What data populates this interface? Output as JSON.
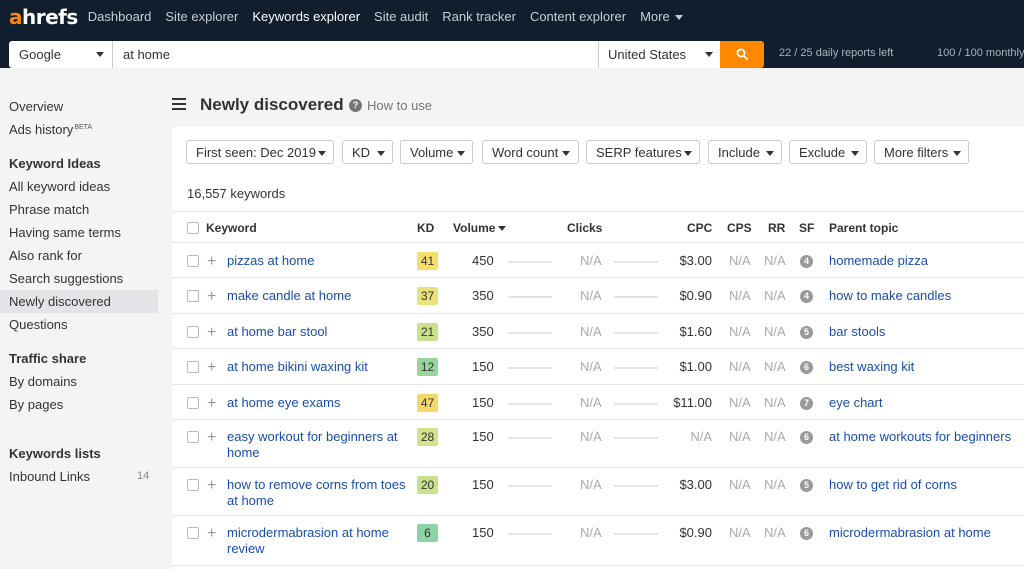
{
  "brand": {
    "logo_a": "a",
    "logo_rest": "hrefs",
    "accent": "#ff8800",
    "nav_bg": "#111e2e",
    "link_color": "#1a4dad"
  },
  "nav": {
    "items": [
      "Dashboard",
      "Site explorer",
      "Keywords explorer",
      "Site audit",
      "Rank tracker",
      "Content explorer",
      "More"
    ],
    "active": "Keywords explorer"
  },
  "search": {
    "engine": "Google",
    "query": "at home",
    "country": "United States",
    "button_icon": "search-icon",
    "reports_left": "22 / 25 daily reports left",
    "monthly": "100 / 100 monthly"
  },
  "sidebar": {
    "overview": "Overview",
    "ads_history": "Ads history",
    "beta": "BETA",
    "keyword_ideas_heading": "Keyword Ideas",
    "keyword_ideas": [
      "All keyword ideas",
      "Phrase match",
      "Having same terms",
      "Also rank for",
      "Search suggestions",
      "Newly discovered",
      "Questions"
    ],
    "active": "Newly discovered",
    "traffic_heading": "Traffic share",
    "traffic_items": [
      "By domains",
      "By pages"
    ],
    "lists_heading": "Keywords lists",
    "inbound_links": "Inbound Links",
    "inbound_count": "14"
  },
  "page": {
    "title": "Newly discovered",
    "how_to": "How to use",
    "keyword_count": "16,557 keywords"
  },
  "filters": [
    "First seen: Dec 2019",
    "KD",
    "Volume",
    "Word count",
    "SERP features",
    "Include",
    "Exclude",
    "More filters"
  ],
  "table": {
    "headers": {
      "keyword": "Keyword",
      "kd": "KD",
      "volume": "Volume",
      "clicks": "Clicks",
      "cpc": "CPC",
      "cps": "CPS",
      "rr": "RR",
      "sf": "SF",
      "parent": "Parent topic"
    },
    "rows": [
      {
        "keyword": "pizzas at home",
        "kd": "41",
        "kd_color": "#f5de6a",
        "volume": "450",
        "clicks": "N/A",
        "cpc": "$3.00",
        "cps": "N/A",
        "rr": "N/A",
        "sf": "4",
        "parent": "homemade pizza"
      },
      {
        "keyword": "make candle at home",
        "kd": "37",
        "kd_color": "#e8e27a",
        "volume": "350",
        "clicks": "N/A",
        "cpc": "$0.90",
        "cps": "N/A",
        "rr": "N/A",
        "sf": "4",
        "parent": "how to make candles"
      },
      {
        "keyword": "at home bar stool",
        "kd": "21",
        "kd_color": "#c9e08c",
        "volume": "350",
        "clicks": "N/A",
        "cpc": "$1.60",
        "cps": "N/A",
        "rr": "N/A",
        "sf": "5",
        "parent": "bar stools"
      },
      {
        "keyword": "at home bikini waxing kit",
        "kd": "12",
        "kd_color": "#97d69b",
        "volume": "150",
        "clicks": "N/A",
        "cpc": "$1.00",
        "cps": "N/A",
        "rr": "N/A",
        "sf": "6",
        "parent": "best waxing kit"
      },
      {
        "keyword": "at home eye exams",
        "kd": "47",
        "kd_color": "#f5d86a",
        "volume": "150",
        "clicks": "N/A",
        "cpc": "$11.00",
        "cps": "N/A",
        "rr": "N/A",
        "sf": "7",
        "parent": "eye chart"
      },
      {
        "keyword": "easy workout for beginners at home",
        "kd": "28",
        "kd_color": "#d4e08a",
        "volume": "150",
        "clicks": "N/A",
        "cpc": "N/A",
        "cps": "N/A",
        "rr": "N/A",
        "sf": "6",
        "parent": "at home workouts for beginners"
      },
      {
        "keyword": "how to remove corns from toes at home",
        "kd": "20",
        "kd_color": "#c9e08c",
        "volume": "150",
        "clicks": "N/A",
        "cpc": "$3.00",
        "cps": "N/A",
        "rr": "N/A",
        "sf": "5",
        "parent": "how to get rid of corns"
      },
      {
        "keyword": "microdermabrasion at home review",
        "kd": "6",
        "kd_color": "#8ed3a3",
        "volume": "150",
        "clicks": "N/A",
        "cpc": "$0.90",
        "cps": "N/A",
        "rr": "N/A",
        "sf": "6",
        "parent": "microdermabrasion at home"
      }
    ]
  }
}
